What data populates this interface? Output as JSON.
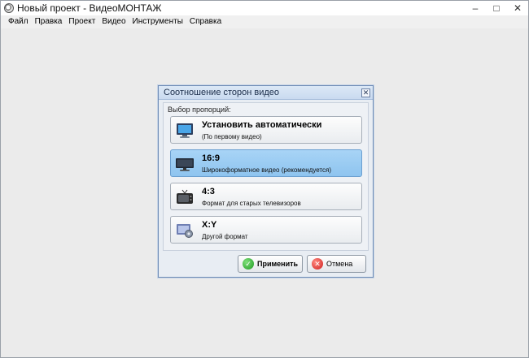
{
  "window": {
    "title": "Новый проект - ВидеоМОНТАЖ",
    "controls": [
      "–",
      "□",
      "✕"
    ]
  },
  "menu": [
    "Файл",
    "Правка",
    "Проект",
    "Видео",
    "Инструменты",
    "Справка"
  ],
  "dialog": {
    "title": "Соотношение сторон видео",
    "close": "✕",
    "group_label": "Выбор пропорций:",
    "options": [
      {
        "title": "Установить автоматически",
        "subtitle": "(По первому видео)",
        "icon": "monitor-auto-icon",
        "selected": false
      },
      {
        "title": "16:9",
        "subtitle": "Широкоформатное видео (рекомендуется)",
        "icon": "widescreen-monitor-icon",
        "selected": true
      },
      {
        "title": "4:3",
        "subtitle": "Формат для старых телевизоров",
        "icon": "old-tv-icon",
        "selected": false
      },
      {
        "title": "X:Y",
        "subtitle": "Другой формат",
        "icon": "custom-format-icon",
        "selected": false
      }
    ],
    "apply_label": "Применить",
    "cancel_label": "Отмена"
  },
  "colors": {
    "selected_fill": "#8ec4ef",
    "dialog_border": "#6e8bb5",
    "ok_green": "#1e9a22",
    "cancel_red": "#d01f1f"
  }
}
